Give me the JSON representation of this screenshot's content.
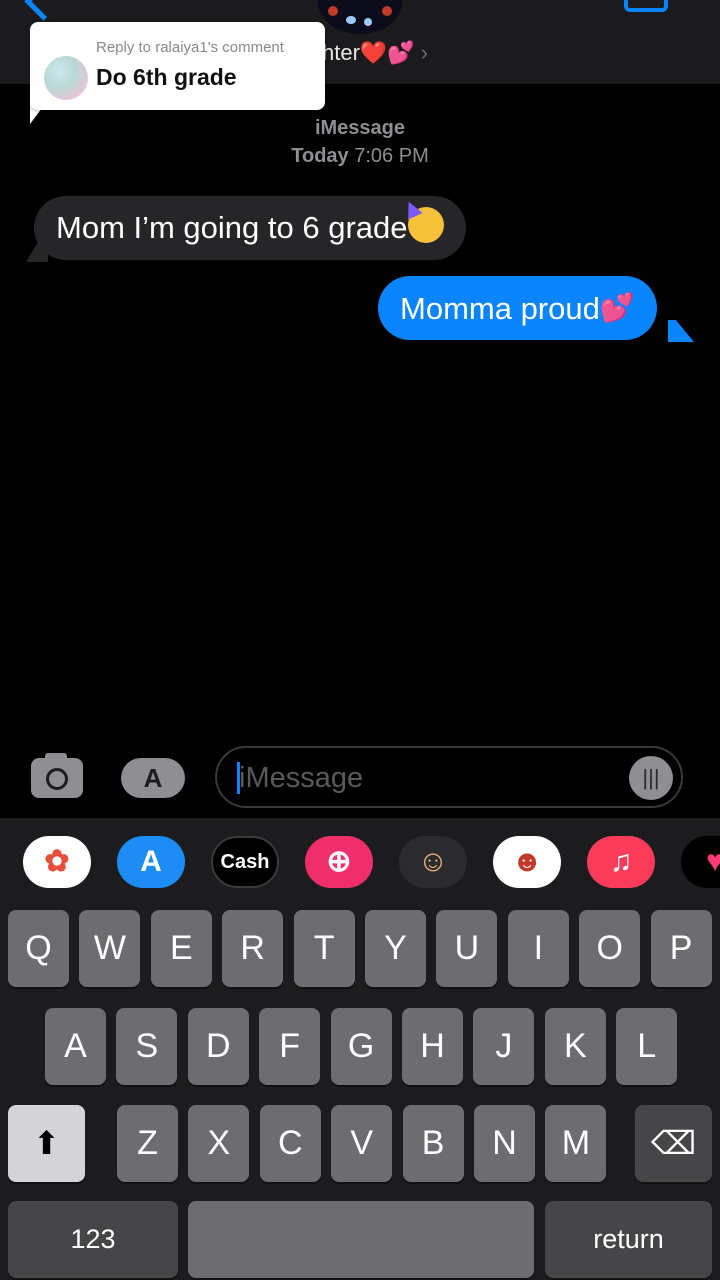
{
  "header": {
    "contact_name_visible": "hter",
    "contact_emojis": "❤️💕",
    "chevron": "›",
    "back_icon": "chevron-left-icon",
    "facetime_icon": "video-camera-icon"
  },
  "reply_card": {
    "label": "Reply to ralaiya1's comment",
    "text": "Do 6th grade"
  },
  "conversation": {
    "service": "iMessage",
    "day": "Today",
    "time": "7:06 PM",
    "messages": [
      {
        "direction": "incoming",
        "text": "Mom I’m going to 6 grade",
        "emoji": "partying-face"
      },
      {
        "direction": "outgoing",
        "text": "Momma proud",
        "emoji": "💕"
      }
    ]
  },
  "composer": {
    "placeholder": "iMessage",
    "camera_icon": "camera-icon",
    "apps_icon": "app-store-icon",
    "voice_icon": "waveform-icon"
  },
  "app_drawer": [
    {
      "name": "photos",
      "label": "",
      "icon": "photos-icon",
      "bg": "#ffffff",
      "fg": "#e84e3c",
      "glyph": "✿"
    },
    {
      "name": "app-store",
      "label": "",
      "icon": "app-store-icon",
      "bg": "#1d8cf5",
      "fg": "#ffffff",
      "glyph": "A"
    },
    {
      "name": "apple-cash",
      "label": "Cash",
      "icon": "apple-cash-icon",
      "bg": "#000000",
      "fg": "#ffffff",
      "glyph": ""
    },
    {
      "name": "search-images",
      "label": "",
      "icon": "globe-search-icon",
      "bg": "#ef2f6b",
      "fg": "#ffffff",
      "glyph": "⊕"
    },
    {
      "name": "memoji",
      "label": "",
      "icon": "memoji-icon",
      "bg": "#2b2b2e",
      "fg": "#f2b37a",
      "glyph": "☺"
    },
    {
      "name": "memoji-stickers",
      "label": "",
      "icon": "memoji-stickers-icon",
      "bg": "#ffffff",
      "fg": "#c0392b",
      "glyph": "☻"
    },
    {
      "name": "music",
      "label": "",
      "icon": "music-icon",
      "bg": "#fb3b5a",
      "fg": "#ffffff",
      "glyph": "♫"
    },
    {
      "name": "digital-touch",
      "label": "",
      "icon": "heart-hands-icon",
      "bg": "#000000",
      "fg": "#ff3b7a",
      "glyph": "♥"
    }
  ],
  "keyboard": {
    "row1": [
      "Q",
      "W",
      "E",
      "R",
      "T",
      "Y",
      "U",
      "I",
      "O",
      "P"
    ],
    "row2": [
      "A",
      "S",
      "D",
      "F",
      "G",
      "H",
      "J",
      "K",
      "L"
    ],
    "row3": [
      "Z",
      "X",
      "C",
      "V",
      "B",
      "N",
      "M"
    ],
    "shift_icon": "shift-arrow-icon",
    "delete_icon": "backspace-icon",
    "numbers_label": "123",
    "return_label": "return"
  }
}
